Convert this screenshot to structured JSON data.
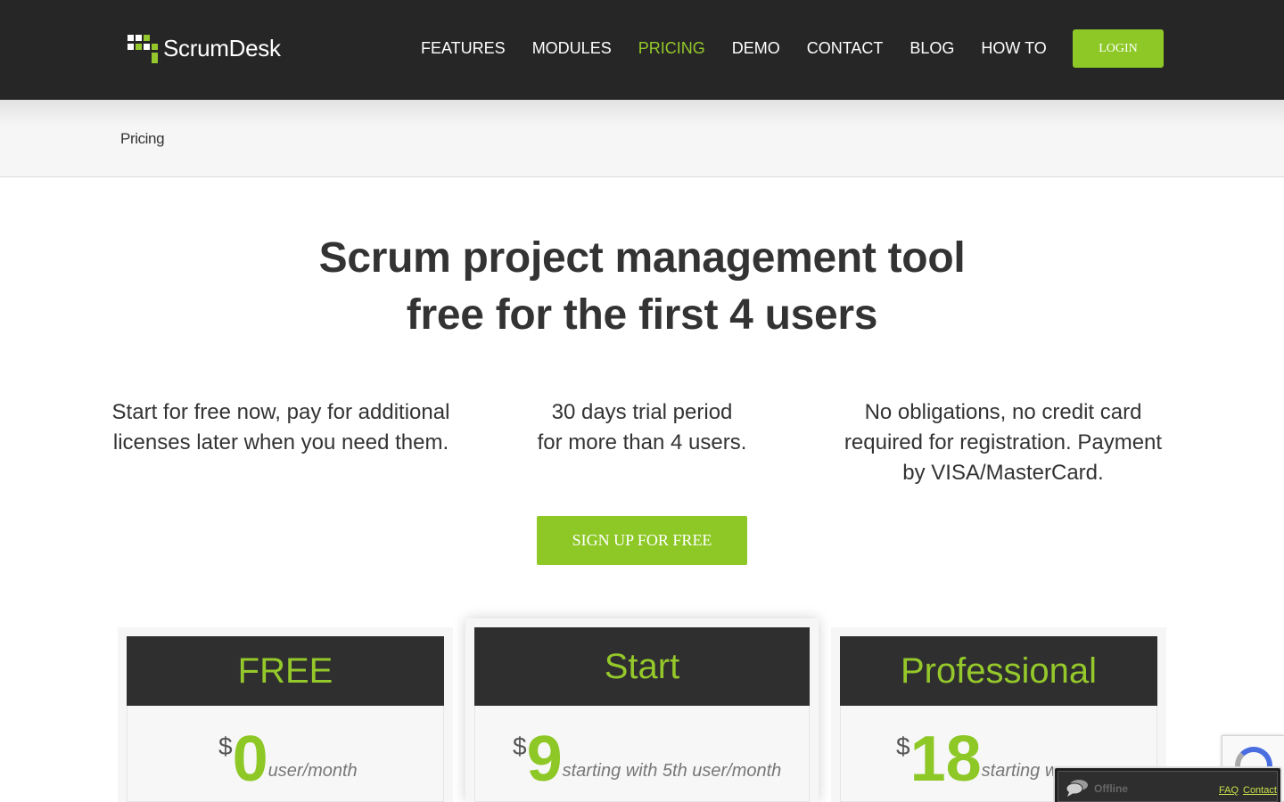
{
  "brand": {
    "name": "ScrumDesk",
    "accent": "#95c82a"
  },
  "nav": {
    "items": [
      {
        "label": "FEATURES"
      },
      {
        "label": "MODULES"
      },
      {
        "label": "PRICING",
        "active": true
      },
      {
        "label": "DEMO"
      },
      {
        "label": "CONTACT"
      },
      {
        "label": "BLOG"
      },
      {
        "label": "HOW TO"
      }
    ],
    "login_label": "LOGIN"
  },
  "breadcrumb": {
    "current": "Pricing"
  },
  "hero": {
    "line1": "Scrum project management tool",
    "line2": "free for the first 4 users"
  },
  "features": [
    {
      "text": "Start for free now, pay for additional licenses later when you need them."
    },
    {
      "line1": "30 days trial period",
      "line2": "for more than 4 users."
    },
    {
      "text": "No obligations, no credit card required for registration. Payment by VISA/MasterCard."
    }
  ],
  "signup": {
    "label": "SIGN UP FOR FREE"
  },
  "plans": [
    {
      "name": "FREE",
      "currency": "$",
      "price": "0",
      "unit": "user/month"
    },
    {
      "name": "Start",
      "currency": "$",
      "price": "9",
      "unit": "starting with 5th user/month"
    },
    {
      "name": "Professional",
      "currency": "$",
      "price": "18",
      "unit": "starting w"
    }
  ],
  "chat": {
    "status": "Offline",
    "faq_label": "FAQ",
    "contact_label": "Contact"
  }
}
